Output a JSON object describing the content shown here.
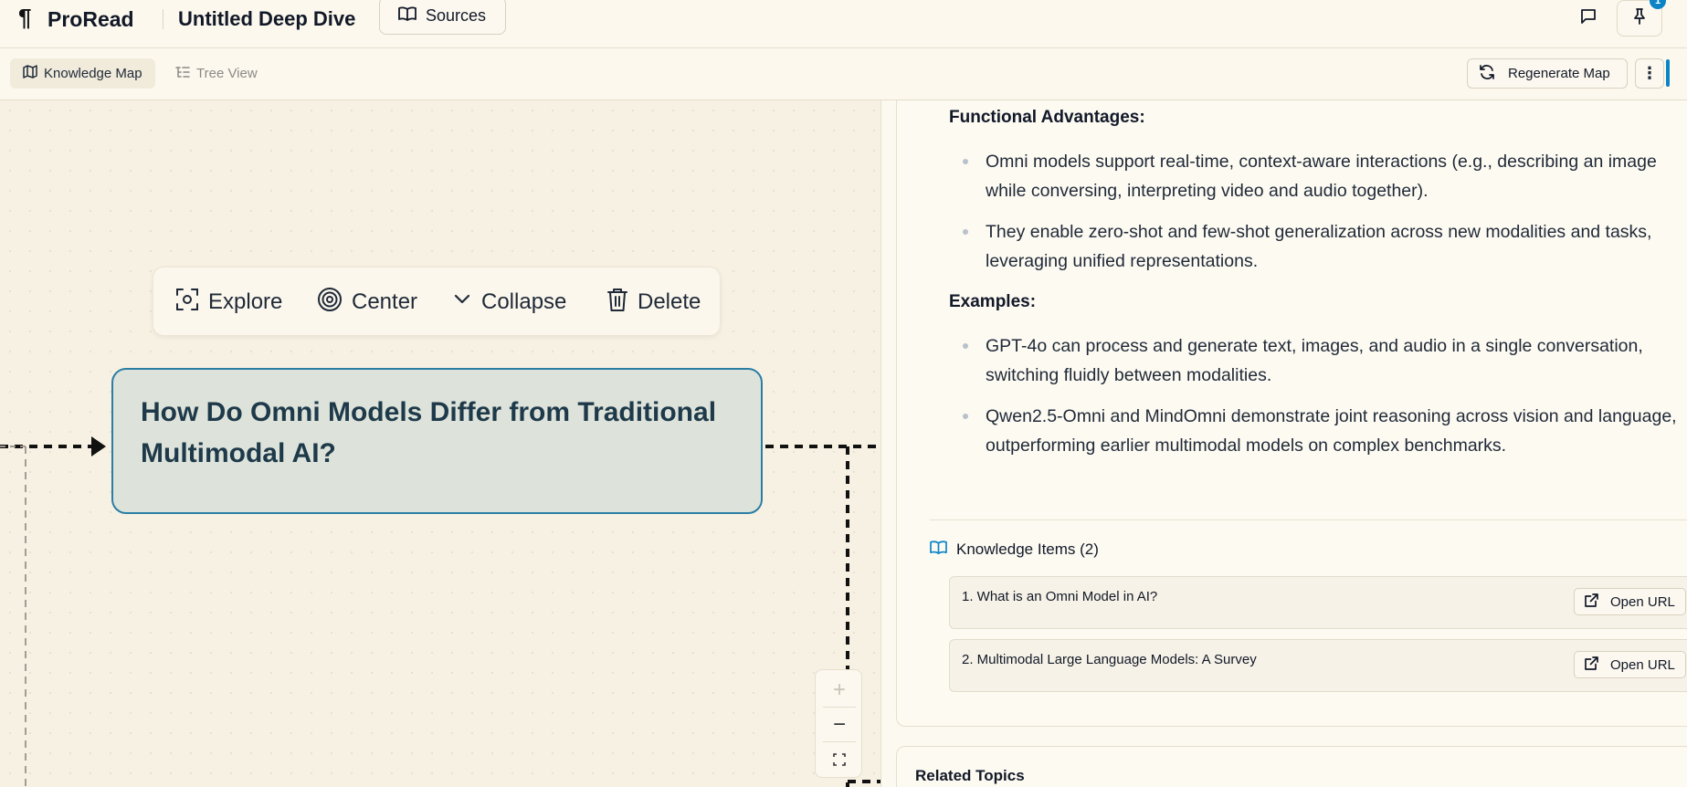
{
  "header": {
    "logo_glyph": "¶",
    "brand": "ProRead",
    "doc_title": "Untitled Deep Dive",
    "sources_label": "Sources",
    "notification_count": "1"
  },
  "toolbar": {
    "tabs": [
      {
        "label": "Knowledge Map",
        "icon": "map-icon",
        "active": true
      },
      {
        "label": "Tree View",
        "icon": "tree-icon",
        "active": false
      }
    ],
    "regenerate_label": "Regenerate Map",
    "more_glyph": "⋮"
  },
  "canvas": {
    "node_menu": [
      {
        "label": "Explore",
        "icon": "explore-focus-icon"
      },
      {
        "label": "Center",
        "icon": "target-icon"
      },
      {
        "label": "Collapse",
        "icon": "chevron-down-icon"
      },
      {
        "label": "Delete",
        "icon": "trash-icon"
      }
    ],
    "node_title": "How Do Omni Models Differ from Traditional Multimodal AI?",
    "zoom": {
      "in": "+",
      "out": "−"
    }
  },
  "panel": {
    "functional_heading": "Functional Advantages:",
    "functional_bullets": [
      "Omni models support real-time, context-aware interactions (e.g., describing an image while conversing, interpreting video and audio together).",
      "They enable zero-shot and few-shot generalization across new modalities and tasks, leveraging unified representations."
    ],
    "examples_heading": "Examples:",
    "example_bullets": [
      "GPT-4o can process and generate text, images, and audio in a single conversation, switching fluidly between modalities.",
      "Qwen2.5-Omni and MindOmni demonstrate joint reasoning across vision and language, outperforming earlier multimodal models on complex benchmarks."
    ],
    "knowledge_items_heading": "Knowledge Items (2)",
    "knowledge_items": [
      {
        "label": "1. What is an Omni Model in AI?",
        "button": "Open URL"
      },
      {
        "label": "2. Multimodal Large Language Models: A Survey",
        "button": "Open URL"
      }
    ],
    "related_topics_heading": "Related Topics"
  },
  "colors": {
    "accent": "#0b84c6",
    "node_border": "#2a7ea4",
    "node_fill": "#dde3da",
    "background": "#faf6ea"
  }
}
